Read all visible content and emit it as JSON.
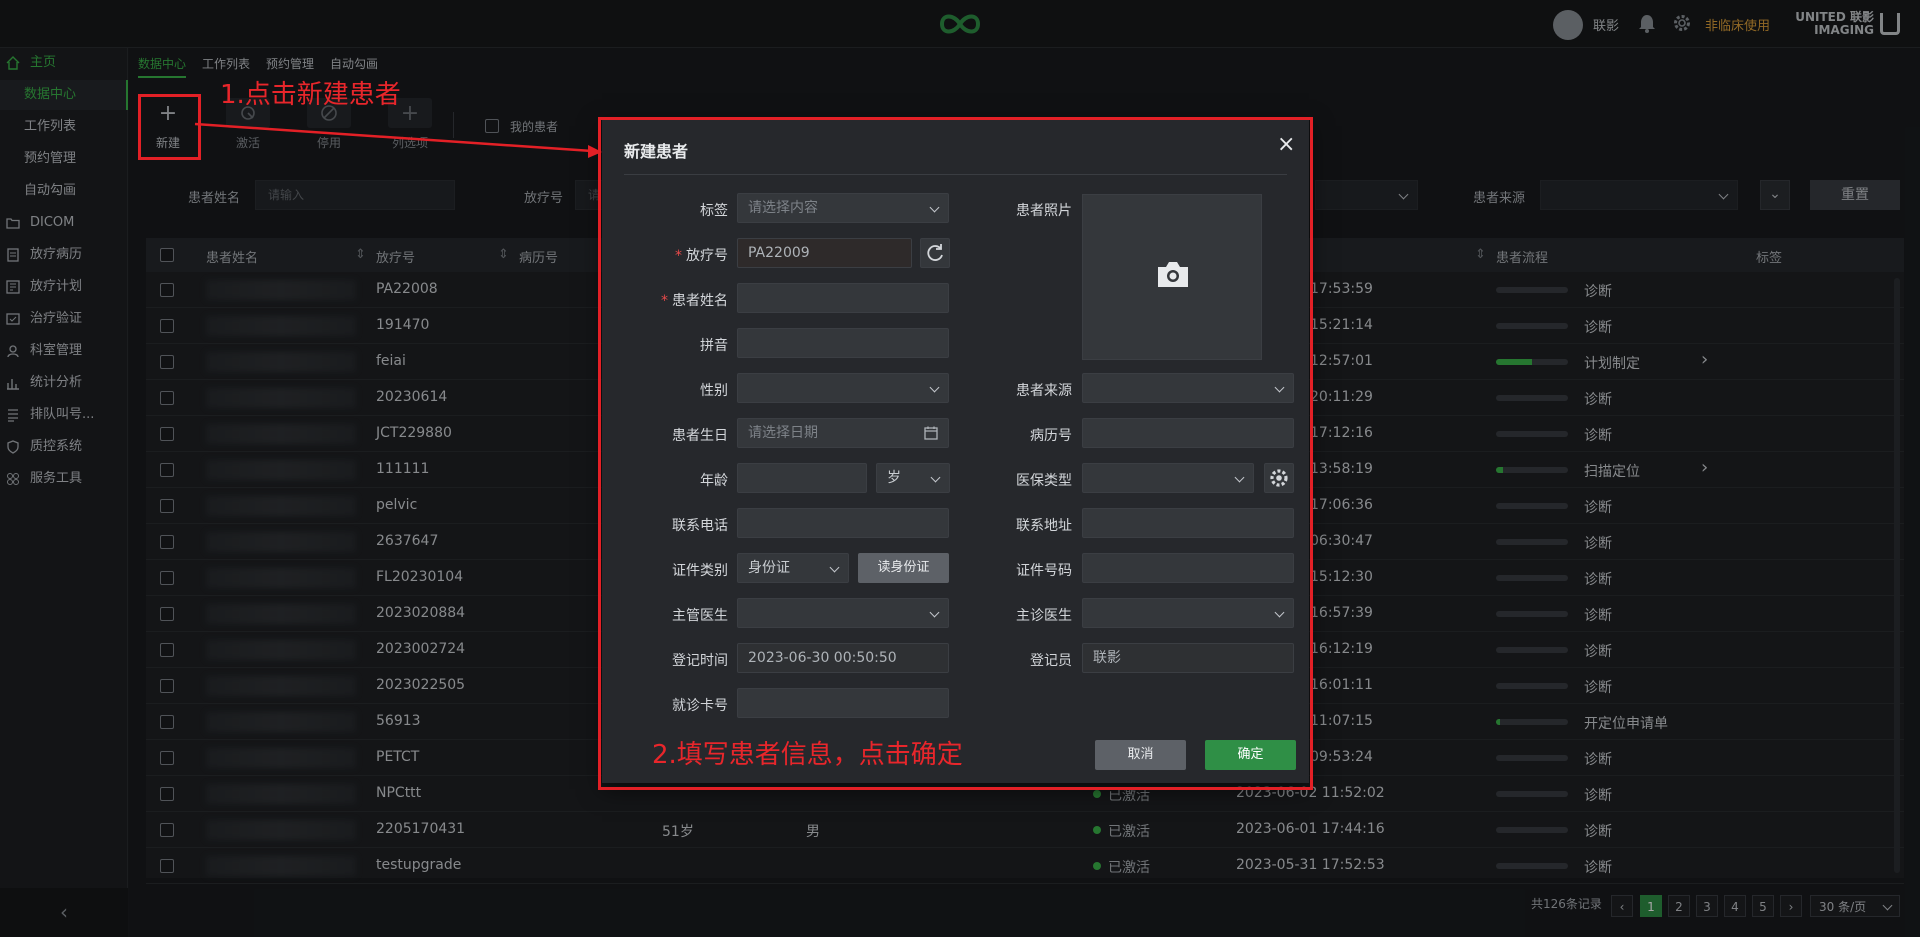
{
  "topbar": {
    "user_name": "联影",
    "non_clinical": "非临床使用",
    "brand_line1": "UNITED 联影",
    "brand_line2": "IMAGING"
  },
  "sidebar": {
    "items": [
      {
        "label": "主页",
        "icon": "home-icon",
        "active": true
      },
      {
        "label": "数据中心",
        "sub": true,
        "active": true
      },
      {
        "label": "工作列表",
        "sub": true
      },
      {
        "label": "预约管理",
        "sub": true
      },
      {
        "label": "自动勾画",
        "sub": true
      },
      {
        "label": "DICOM",
        "icon": "folder-icon"
      },
      {
        "label": "放疗病历",
        "icon": "record-icon"
      },
      {
        "label": "放疗计划",
        "icon": "plan-icon"
      },
      {
        "label": "治疗验证",
        "icon": "verify-icon"
      },
      {
        "label": "科室管理",
        "icon": "department-icon"
      },
      {
        "label": "统计分析",
        "icon": "chart-icon"
      },
      {
        "label": "排队叫号...",
        "icon": "queue-icon"
      },
      {
        "label": "质控系统",
        "icon": "shield-icon"
      },
      {
        "label": "服务工具",
        "icon": "tools-icon"
      }
    ],
    "collapse": "‹"
  },
  "subtabs": [
    "数据中心",
    "工作列表",
    "预约管理",
    "自动勾画"
  ],
  "toolbar": {
    "new": "新建",
    "activate": "激活",
    "disable": "停用",
    "columns": "列选项",
    "my_patients": "我的患者"
  },
  "filters": {
    "patient_name_label": "患者姓名",
    "patient_name_placeholder": "请输入",
    "rt_id_label": "放疗号",
    "rt_id_placeholder": "请",
    "source_label": "患者来源",
    "reset": "重置"
  },
  "table": {
    "headers": {
      "name": "患者姓名",
      "rt_id": "放疗号",
      "record_no": "病历号",
      "flow": "患者流程",
      "tag": "标签"
    },
    "rows": [
      {
        "id": "PA22008",
        "time": "17:53:59",
        "flow": "诊断",
        "progress": 0
      },
      {
        "id": "191470",
        "time": "15:21:14",
        "flow": "诊断",
        "progress": 0
      },
      {
        "id": "feiai",
        "time": "12:57:01",
        "flow": "计划制定",
        "progress": 0.5,
        "arrow": "›"
      },
      {
        "id": "20230614",
        "time": "20:11:29",
        "flow": "诊断",
        "progress": 0
      },
      {
        "id": "JCT229880",
        "time": "17:12:16",
        "flow": "诊断",
        "progress": 0
      },
      {
        "id": "111111",
        "time": "13:58:19",
        "flow": "扫描定位",
        "progress": 0.1,
        "arrow": "›"
      },
      {
        "id": "pelvic",
        "time": "17:06:36",
        "flow": "诊断",
        "progress": 0
      },
      {
        "id": "2637647",
        "time": "06:30:47",
        "flow": "诊断",
        "progress": 0
      },
      {
        "id": "FL20230104",
        "time": "15:12:30",
        "flow": "诊断",
        "progress": 0
      },
      {
        "id": "2023020884",
        "time": "16:57:39",
        "flow": "诊断",
        "progress": 0
      },
      {
        "id": "2023002724",
        "time": "16:12:19",
        "flow": "诊断",
        "progress": 0
      },
      {
        "id": "2023022505",
        "time": "16:01:11",
        "flow": "诊断",
        "progress": 0
      },
      {
        "id": "56913",
        "time": "11:07:15",
        "flow": "开定位申请单",
        "progress": 0.05
      },
      {
        "id": "PETCT",
        "time": "09:53:24",
        "flow": "诊断",
        "progress": 0
      },
      {
        "id": "NPCttt",
        "status": "已激活",
        "time": "2023-06-02 11:52:02",
        "flow": "诊断",
        "progress": 0
      },
      {
        "id": "2205170431",
        "age": "51岁",
        "sex": "男",
        "status": "已激活",
        "time": "2023-06-01 17:44:16",
        "flow": "诊断",
        "progress": 0
      },
      {
        "id": "testupgrade",
        "status": "已激活",
        "time": "2023-05-31 17:52:53",
        "flow": "诊断",
        "progress": 0
      }
    ]
  },
  "pagination": {
    "total": "共126条记录",
    "prev": "‹",
    "pages": [
      "1",
      "2",
      "3",
      "4",
      "5"
    ],
    "next": "›",
    "page_size": "30 条/页"
  },
  "dialog": {
    "title": "新建患者",
    "close": "×",
    "fields": {
      "tag_label": "标签",
      "tag_placeholder": "请选择内容",
      "rt_id_label": "放疗号",
      "rt_id_value": "PA22009",
      "name_label": "患者姓名",
      "pinyin_label": "拼音",
      "gender_label": "性别",
      "birthday_label": "患者生日",
      "birthday_placeholder": "请选择日期",
      "age_label": "年龄",
      "age_unit": "岁",
      "phone_label": "联系电话",
      "id_type_label": "证件类别",
      "id_type_value": "身份证",
      "read_id_button": "读身份证",
      "doctor_label": "主管医生",
      "reg_time_label": "登记时间",
      "reg_time_value": "2023-06-30 00:50:50",
      "card_label": "就诊卡号",
      "photo_label": "患者照片",
      "source_label": "患者来源",
      "record_label": "病历号",
      "insurance_label": "医保类型",
      "address_label": "联系地址",
      "id_no_label": "证件号码",
      "attending_label": "主诊医生",
      "registrar_label": "登记员",
      "registrar_value": "联影"
    },
    "cancel": "取消",
    "confirm": "确定"
  },
  "annotations": {
    "step1": "1.点击新建患者",
    "step2": "2.填写患者信息，点击确定"
  },
  "colors": {
    "accent_green": "#3bb54a",
    "annotation_red": "#e32026",
    "warning_orange": "#e0a23a"
  }
}
